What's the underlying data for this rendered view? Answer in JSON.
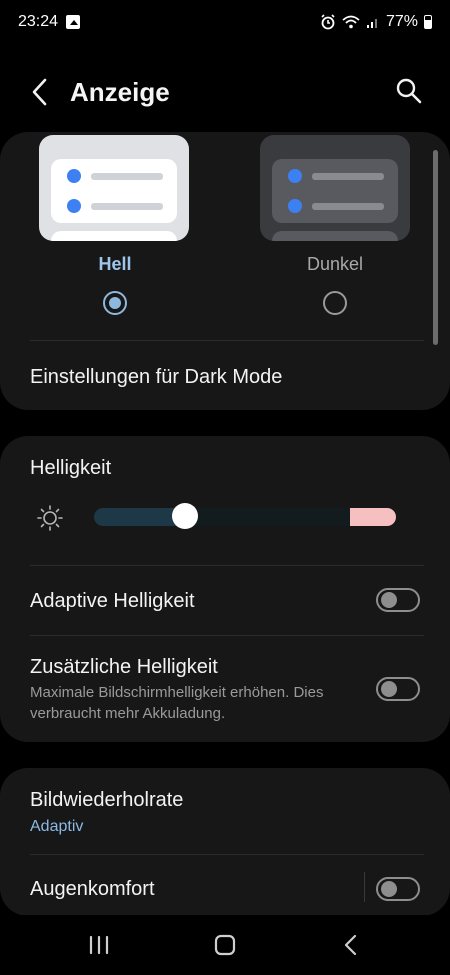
{
  "status_bar": {
    "time": "23:24",
    "battery": "77%",
    "icons": [
      "gallery-icon",
      "alarm-icon",
      "wifi-icon",
      "signal-icon",
      "battery-icon"
    ]
  },
  "app_bar": {
    "title": "Anzeige",
    "back_icon": "chevron-left-icon",
    "search_icon": "search-icon"
  },
  "theme": {
    "light_label": "Hell",
    "dark_label": "Dunkel",
    "selected": "light",
    "dark_mode_settings_label": "Einstellungen für Dark Mode",
    "accent_color": "#9cc7ea"
  },
  "brightness": {
    "title": "Helligkeit",
    "level_fraction": 0.3,
    "adaptive_label": "Adaptive Helligkeit",
    "adaptive_enabled": false,
    "extra_label": "Zusätzliche Helligkeit",
    "extra_description": "Maximale Bildschirmhelligkeit erhöhen. Dies verbraucht mehr Akkuladung.",
    "extra_enabled": false
  },
  "display_options": {
    "refresh_rate_label": "Bildwiederholrate",
    "refresh_rate_value": "Adaptiv",
    "eye_comfort_label": "Augenkomfort",
    "eye_comfort_enabled": false
  },
  "nav_bar": {
    "icons": [
      "recents-icon",
      "home-icon",
      "back-icon"
    ]
  }
}
